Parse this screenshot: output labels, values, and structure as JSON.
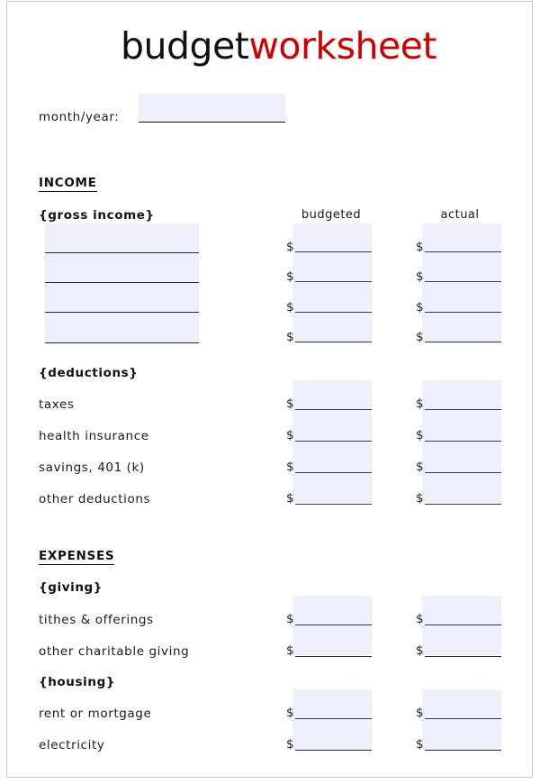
{
  "page": {
    "title_part1": "budget",
    "title_part2": "worksheet",
    "accent_color": "#cc0000",
    "field_fill_color": "#edeffb",
    "text_color": "#1a1a1a",
    "border_color": "#c9c9c9"
  },
  "month_year": {
    "label": "month/year:",
    "value": "",
    "placeholder": ""
  },
  "columns": {
    "budgeted": "budgeted",
    "actual": "actual",
    "currency_symbol": "$"
  },
  "sections": [
    {
      "heading": "INCOME",
      "groups": [
        {
          "name": "{gross income}",
          "has_name_inputs": true,
          "rows": [
            {
              "label": "",
              "budgeted": "",
              "actual": ""
            },
            {
              "label": "",
              "budgeted": "",
              "actual": ""
            },
            {
              "label": "",
              "budgeted": "",
              "actual": ""
            },
            {
              "label": "",
              "budgeted": "",
              "actual": ""
            }
          ]
        },
        {
          "name": "{deductions}",
          "has_name_inputs": false,
          "rows": [
            {
              "label": "taxes",
              "budgeted": "",
              "actual": ""
            },
            {
              "label": "health insurance",
              "budgeted": "",
              "actual": ""
            },
            {
              "label": "savings, 401 (k)",
              "budgeted": "",
              "actual": ""
            },
            {
              "label": "other deductions",
              "budgeted": "",
              "actual": ""
            }
          ]
        }
      ]
    },
    {
      "heading": "EXPENSES",
      "groups": [
        {
          "name": "{giving}",
          "has_name_inputs": false,
          "rows": [
            {
              "label": "tithes & offerings",
              "budgeted": "",
              "actual": ""
            },
            {
              "label": "other charitable giving",
              "budgeted": "",
              "actual": ""
            }
          ]
        },
        {
          "name": "{housing}",
          "has_name_inputs": false,
          "rows": [
            {
              "label": "rent or mortgage",
              "budgeted": "",
              "actual": ""
            },
            {
              "label": "electricity",
              "budgeted": "",
              "actual": ""
            }
          ]
        }
      ]
    }
  ]
}
